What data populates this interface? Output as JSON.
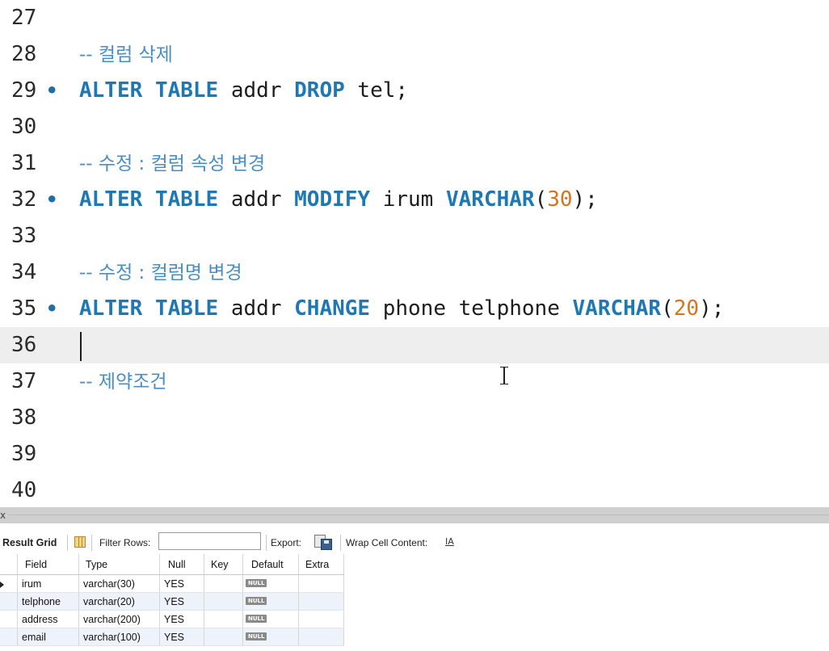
{
  "editor": {
    "lines": [
      {
        "n": "27",
        "marker": false,
        "current": false,
        "tokens": []
      },
      {
        "n": "28",
        "marker": false,
        "current": false,
        "tokens": [
          {
            "t": "-- 컬럼 삭제",
            "c": "cm"
          }
        ]
      },
      {
        "n": "29",
        "marker": true,
        "current": false,
        "tokens": [
          {
            "t": "ALTER",
            "c": "kw"
          },
          {
            "t": " ",
            "c": "id"
          },
          {
            "t": "TABLE",
            "c": "kw"
          },
          {
            "t": " addr ",
            "c": "id"
          },
          {
            "t": "DROP",
            "c": "kw"
          },
          {
            "t": " tel;",
            "c": "id"
          }
        ]
      },
      {
        "n": "30",
        "marker": false,
        "current": false,
        "tokens": []
      },
      {
        "n": "31",
        "marker": false,
        "current": false,
        "tokens": [
          {
            "t": "-- 수정 : 컬럼 속성 변경",
            "c": "cm"
          }
        ]
      },
      {
        "n": "32",
        "marker": true,
        "current": false,
        "tokens": [
          {
            "t": "ALTER",
            "c": "kw"
          },
          {
            "t": " ",
            "c": "id"
          },
          {
            "t": "TABLE",
            "c": "kw"
          },
          {
            "t": " addr ",
            "c": "id"
          },
          {
            "t": "MODIFY",
            "c": "kw"
          },
          {
            "t": " irum ",
            "c": "id"
          },
          {
            "t": "VARCHAR",
            "c": "kw"
          },
          {
            "t": "(",
            "c": "id"
          },
          {
            "t": "30",
            "c": "num"
          },
          {
            "t": ");",
            "c": "id"
          }
        ]
      },
      {
        "n": "33",
        "marker": false,
        "current": false,
        "tokens": []
      },
      {
        "n": "34",
        "marker": false,
        "current": false,
        "tokens": [
          {
            "t": "-- 수정 : 컬럼명 변경",
            "c": "cm"
          }
        ]
      },
      {
        "n": "35",
        "marker": true,
        "current": false,
        "tokens": [
          {
            "t": "ALTER",
            "c": "kw"
          },
          {
            "t": " ",
            "c": "id"
          },
          {
            "t": "TABLE",
            "c": "kw"
          },
          {
            "t": " addr ",
            "c": "id"
          },
          {
            "t": "CHANGE",
            "c": "kw"
          },
          {
            "t": " phone telphone ",
            "c": "id"
          },
          {
            "t": "VARCHAR",
            "c": "kw"
          },
          {
            "t": "(",
            "c": "id"
          },
          {
            "t": "20",
            "c": "num"
          },
          {
            "t": ");",
            "c": "id"
          }
        ]
      },
      {
        "n": "36",
        "marker": false,
        "current": true,
        "tokens": []
      },
      {
        "n": "37",
        "marker": false,
        "current": false,
        "tokens": [
          {
            "t": "-- 제약조건",
            "c": "cm"
          }
        ]
      },
      {
        "n": "38",
        "marker": false,
        "current": false,
        "tokens": []
      },
      {
        "n": "39",
        "marker": false,
        "current": false,
        "tokens": []
      },
      {
        "n": "40",
        "marker": false,
        "current": false,
        "tokens": []
      }
    ],
    "marker_glyph": "•"
  },
  "splitter": {
    "close_glyph": "x"
  },
  "toolbar": {
    "result_grid_label": "Result Grid",
    "filter_rows_label": "Filter Rows:",
    "filter_value": "",
    "export_label": "Export:",
    "wrap_label": "Wrap Cell Content:",
    "wrap_icon_text": "IA"
  },
  "result": {
    "columns": [
      "Field",
      "Type",
      "Null",
      "Key",
      "Default",
      "Extra"
    ],
    "rows": [
      {
        "field": "irum",
        "type": "varchar(30)",
        "null": "YES",
        "key": "",
        "default": "NULL",
        "extra": "",
        "selected": true
      },
      {
        "field": "telphone",
        "type": "varchar(20)",
        "null": "YES",
        "key": "",
        "default": "NULL",
        "extra": "",
        "selected": false
      },
      {
        "field": "address",
        "type": "varchar(200)",
        "null": "YES",
        "key": "",
        "default": "NULL",
        "extra": "",
        "selected": false
      },
      {
        "field": "email",
        "type": "varchar(100)",
        "null": "YES",
        "key": "",
        "default": "NULL",
        "extra": "",
        "selected": false
      }
    ]
  }
}
